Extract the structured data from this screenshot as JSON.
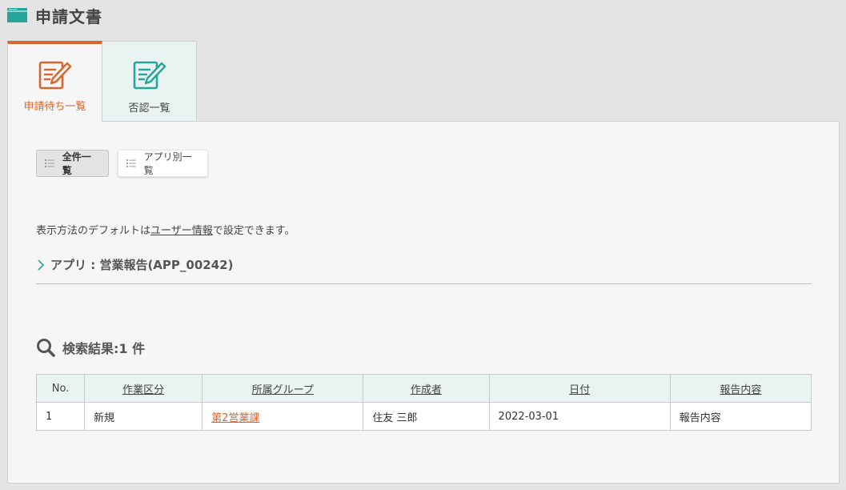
{
  "header": {
    "title": "申請文書"
  },
  "tabs": [
    {
      "label": "申請待ち一覧",
      "active": true
    },
    {
      "label": "否認一覧",
      "active": false
    }
  ],
  "view_buttons": [
    {
      "label": "全件一覧",
      "active": true
    },
    {
      "label": "アプリ別一覧",
      "active": false
    }
  ],
  "hint": {
    "prefix": "表示方法のデフォルトは",
    "link": "ユーザー情報",
    "suffix": "で設定できます。"
  },
  "app_section": {
    "label": "アプリ : 営業報告(APP_00242)"
  },
  "search_result": {
    "label": "検索結果:1 件"
  },
  "table": {
    "columns": [
      "No.",
      "作業区分",
      "所属グループ",
      "作成者",
      "日付",
      "報告内容"
    ],
    "rows": [
      [
        "1",
        "新規",
        "第2営業課",
        "住友 三郎",
        "2022-03-01",
        "報告内容"
      ]
    ]
  },
  "colors": {
    "accent": "#d8662c",
    "teal": "#26a59a",
    "tab_bg": "#e8f3f2"
  }
}
